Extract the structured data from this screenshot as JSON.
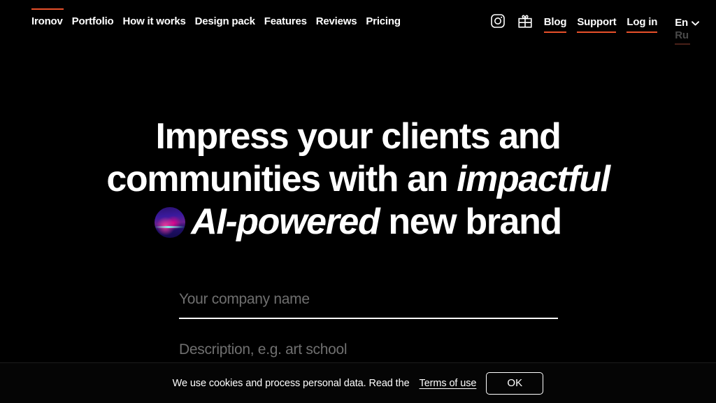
{
  "header": {
    "brand": {
      "label": "Ironov",
      "accent_color": "#e8502a"
    },
    "nav_items": [
      {
        "label": "Portfolio"
      },
      {
        "label": "How it works"
      },
      {
        "label": "Design pack"
      },
      {
        "label": "Features"
      },
      {
        "label": "Reviews"
      },
      {
        "label": "Pricing"
      }
    ],
    "icons": [
      {
        "name": "instagram-icon"
      },
      {
        "name": "gift-icon"
      }
    ],
    "links": [
      {
        "label": "Blog"
      },
      {
        "label": "Support"
      },
      {
        "label": "Log in"
      }
    ],
    "language": {
      "current": "En",
      "option": "Ru"
    }
  },
  "hero": {
    "line1": "Impress your clients and",
    "line2_pre": "communities with an ",
    "line2_em": "impactful",
    "line3_em": "AI-powered",
    "line3_post": " new brand"
  },
  "form": {
    "company": {
      "placeholder": "Your company name",
      "value": ""
    },
    "description": {
      "placeholder": "Description, e.g. art school",
      "value": ""
    }
  },
  "cookie": {
    "message": "We use cookies and process personal data. Read the",
    "link": "Terms of use",
    "accept": "OK"
  }
}
